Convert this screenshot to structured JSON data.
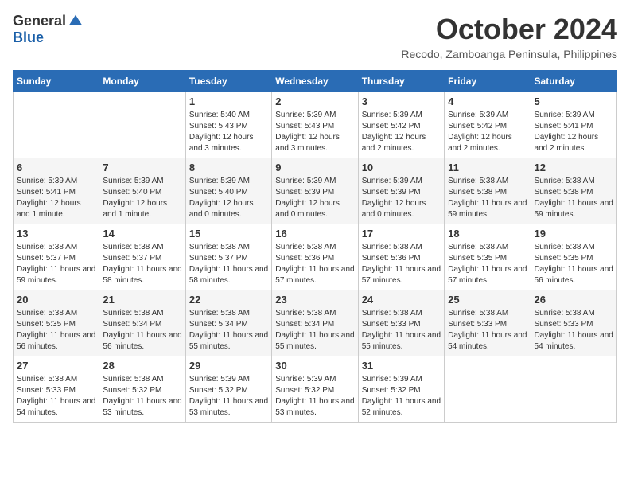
{
  "header": {
    "logo_general": "General",
    "logo_blue": "Blue",
    "month_title": "October 2024",
    "location": "Recodo, Zamboanga Peninsula, Philippines"
  },
  "calendar": {
    "days_of_week": [
      "Sunday",
      "Monday",
      "Tuesday",
      "Wednesday",
      "Thursday",
      "Friday",
      "Saturday"
    ],
    "weeks": [
      [
        {
          "day": "",
          "sunrise": "",
          "sunset": "",
          "daylight": ""
        },
        {
          "day": "",
          "sunrise": "",
          "sunset": "",
          "daylight": ""
        },
        {
          "day": "1",
          "sunrise": "Sunrise: 5:40 AM",
          "sunset": "Sunset: 5:43 PM",
          "daylight": "Daylight: 12 hours and 3 minutes."
        },
        {
          "day": "2",
          "sunrise": "Sunrise: 5:39 AM",
          "sunset": "Sunset: 5:43 PM",
          "daylight": "Daylight: 12 hours and 3 minutes."
        },
        {
          "day": "3",
          "sunrise": "Sunrise: 5:39 AM",
          "sunset": "Sunset: 5:42 PM",
          "daylight": "Daylight: 12 hours and 2 minutes."
        },
        {
          "day": "4",
          "sunrise": "Sunrise: 5:39 AM",
          "sunset": "Sunset: 5:42 PM",
          "daylight": "Daylight: 12 hours and 2 minutes."
        },
        {
          "day": "5",
          "sunrise": "Sunrise: 5:39 AM",
          "sunset": "Sunset: 5:41 PM",
          "daylight": "Daylight: 12 hours and 2 minutes."
        }
      ],
      [
        {
          "day": "6",
          "sunrise": "Sunrise: 5:39 AM",
          "sunset": "Sunset: 5:41 PM",
          "daylight": "Daylight: 12 hours and 1 minute."
        },
        {
          "day": "7",
          "sunrise": "Sunrise: 5:39 AM",
          "sunset": "Sunset: 5:40 PM",
          "daylight": "Daylight: 12 hours and 1 minute."
        },
        {
          "day": "8",
          "sunrise": "Sunrise: 5:39 AM",
          "sunset": "Sunset: 5:40 PM",
          "daylight": "Daylight: 12 hours and 0 minutes."
        },
        {
          "day": "9",
          "sunrise": "Sunrise: 5:39 AM",
          "sunset": "Sunset: 5:39 PM",
          "daylight": "Daylight: 12 hours and 0 minutes."
        },
        {
          "day": "10",
          "sunrise": "Sunrise: 5:39 AM",
          "sunset": "Sunset: 5:39 PM",
          "daylight": "Daylight: 12 hours and 0 minutes."
        },
        {
          "day": "11",
          "sunrise": "Sunrise: 5:38 AM",
          "sunset": "Sunset: 5:38 PM",
          "daylight": "Daylight: 11 hours and 59 minutes."
        },
        {
          "day": "12",
          "sunrise": "Sunrise: 5:38 AM",
          "sunset": "Sunset: 5:38 PM",
          "daylight": "Daylight: 11 hours and 59 minutes."
        }
      ],
      [
        {
          "day": "13",
          "sunrise": "Sunrise: 5:38 AM",
          "sunset": "Sunset: 5:37 PM",
          "daylight": "Daylight: 11 hours and 59 minutes."
        },
        {
          "day": "14",
          "sunrise": "Sunrise: 5:38 AM",
          "sunset": "Sunset: 5:37 PM",
          "daylight": "Daylight: 11 hours and 58 minutes."
        },
        {
          "day": "15",
          "sunrise": "Sunrise: 5:38 AM",
          "sunset": "Sunset: 5:37 PM",
          "daylight": "Daylight: 11 hours and 58 minutes."
        },
        {
          "day": "16",
          "sunrise": "Sunrise: 5:38 AM",
          "sunset": "Sunset: 5:36 PM",
          "daylight": "Daylight: 11 hours and 57 minutes."
        },
        {
          "day": "17",
          "sunrise": "Sunrise: 5:38 AM",
          "sunset": "Sunset: 5:36 PM",
          "daylight": "Daylight: 11 hours and 57 minutes."
        },
        {
          "day": "18",
          "sunrise": "Sunrise: 5:38 AM",
          "sunset": "Sunset: 5:35 PM",
          "daylight": "Daylight: 11 hours and 57 minutes."
        },
        {
          "day": "19",
          "sunrise": "Sunrise: 5:38 AM",
          "sunset": "Sunset: 5:35 PM",
          "daylight": "Daylight: 11 hours and 56 minutes."
        }
      ],
      [
        {
          "day": "20",
          "sunrise": "Sunrise: 5:38 AM",
          "sunset": "Sunset: 5:35 PM",
          "daylight": "Daylight: 11 hours and 56 minutes."
        },
        {
          "day": "21",
          "sunrise": "Sunrise: 5:38 AM",
          "sunset": "Sunset: 5:34 PM",
          "daylight": "Daylight: 11 hours and 56 minutes."
        },
        {
          "day": "22",
          "sunrise": "Sunrise: 5:38 AM",
          "sunset": "Sunset: 5:34 PM",
          "daylight": "Daylight: 11 hours and 55 minutes."
        },
        {
          "day": "23",
          "sunrise": "Sunrise: 5:38 AM",
          "sunset": "Sunset: 5:34 PM",
          "daylight": "Daylight: 11 hours and 55 minutes."
        },
        {
          "day": "24",
          "sunrise": "Sunrise: 5:38 AM",
          "sunset": "Sunset: 5:33 PM",
          "daylight": "Daylight: 11 hours and 55 minutes."
        },
        {
          "day": "25",
          "sunrise": "Sunrise: 5:38 AM",
          "sunset": "Sunset: 5:33 PM",
          "daylight": "Daylight: 11 hours and 54 minutes."
        },
        {
          "day": "26",
          "sunrise": "Sunrise: 5:38 AM",
          "sunset": "Sunset: 5:33 PM",
          "daylight": "Daylight: 11 hours and 54 minutes."
        }
      ],
      [
        {
          "day": "27",
          "sunrise": "Sunrise: 5:38 AM",
          "sunset": "Sunset: 5:33 PM",
          "daylight": "Daylight: 11 hours and 54 minutes."
        },
        {
          "day": "28",
          "sunrise": "Sunrise: 5:38 AM",
          "sunset": "Sunset: 5:32 PM",
          "daylight": "Daylight: 11 hours and 53 minutes."
        },
        {
          "day": "29",
          "sunrise": "Sunrise: 5:39 AM",
          "sunset": "Sunset: 5:32 PM",
          "daylight": "Daylight: 11 hours and 53 minutes."
        },
        {
          "day": "30",
          "sunrise": "Sunrise: 5:39 AM",
          "sunset": "Sunset: 5:32 PM",
          "daylight": "Daylight: 11 hours and 53 minutes."
        },
        {
          "day": "31",
          "sunrise": "Sunrise: 5:39 AM",
          "sunset": "Sunset: 5:32 PM",
          "daylight": "Daylight: 11 hours and 52 minutes."
        },
        {
          "day": "",
          "sunrise": "",
          "sunset": "",
          "daylight": ""
        },
        {
          "day": "",
          "sunrise": "",
          "sunset": "",
          "daylight": ""
        }
      ]
    ]
  }
}
